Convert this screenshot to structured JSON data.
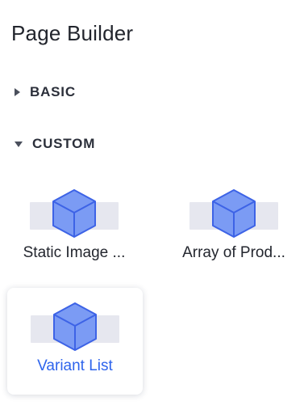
{
  "panel": {
    "title": "Page Builder"
  },
  "sections": {
    "basic": {
      "label": "BASIC",
      "expanded": false
    },
    "custom": {
      "label": "CUSTOM",
      "expanded": true
    }
  },
  "components": [
    {
      "label": "Static Image ...",
      "icon": "cube-icon",
      "selected": false
    },
    {
      "label": "Array of Prod...",
      "icon": "cube-icon",
      "selected": false
    },
    {
      "label": "Variant List",
      "icon": "cube-icon",
      "selected": true
    }
  ],
  "colors": {
    "cube_fill": "#7b9bf4",
    "cube_stroke": "#3d63e6",
    "selected_text": "#2e64ec",
    "thumb_bg": "#e6e7ef"
  }
}
